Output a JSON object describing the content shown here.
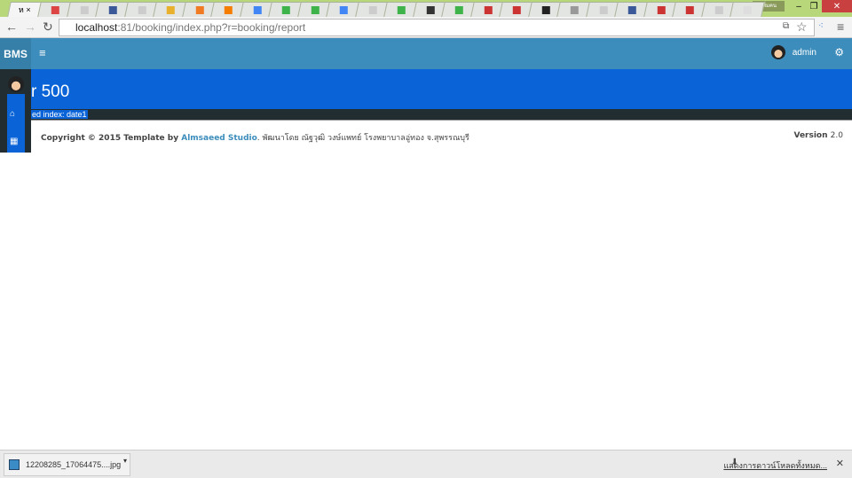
{
  "browser": {
    "active_tab_label": "ห ×",
    "tab_icons": [
      "gmail",
      "page",
      "facebook",
      "page",
      "image",
      "xampp",
      "blogger",
      "google",
      "sheet",
      "sheet",
      "google",
      "page",
      "sheet",
      "play",
      "sheet",
      "app",
      "app",
      "r",
      "dot",
      "page",
      "facebook",
      "app",
      "app",
      "page",
      "blank"
    ],
    "profile_label": "เพิ่มคน",
    "url_host": "localhost",
    "url_rest": ":81/booking/index.php?r=booking/report"
  },
  "header": {
    "logo": "BMS",
    "menu_icon": "≡",
    "username": "admin"
  },
  "banner": {
    "title": "r 500"
  },
  "error": {
    "text": "ed index: date1"
  },
  "footer": {
    "copyright": "Copyright © 2015 Template by ",
    "studio": "Almsaeed Studio",
    "thai": ". พัฒนาโดย ณัฐวุฒิ วงษ์แพทย์ โรงพยาบาลอู่ทอง จ.สุพรรณบุรี",
    "version_label": "Version",
    "version": "2.0"
  },
  "downloads": {
    "file": "12208285_17064475....jpg",
    "show_all": "แสดงการดาวน์โหลดทั้งหมด..."
  }
}
